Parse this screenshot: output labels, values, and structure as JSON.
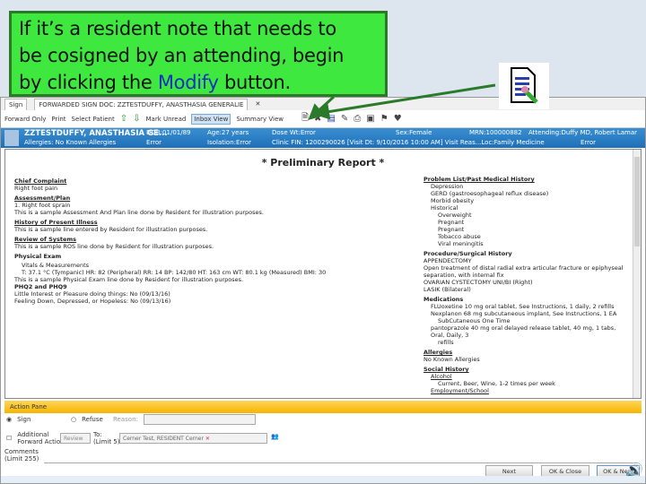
{
  "callout": {
    "line1": "If it’s a resident note that needs to",
    "line2": "be cosigned by an attending, begin",
    "line3_pre": "by clicking the ",
    "line3_hl": "Modify",
    "line3_post": " button."
  },
  "tabs": [
    {
      "label": "Sign"
    },
    {
      "label": "FORWARDED SIGN DOC: ZZTESTDUFFY, ANASTHASIA GENERALIE"
    }
  ],
  "toolbar": {
    "forward_only": "Forward Only",
    "print": "Print",
    "select_patient": "Select Patient",
    "mark_unread": "Mark Unread",
    "inbox_view": "Inbox View",
    "summary_view": "Summary View"
  },
  "banner": {
    "name": "ZZTESTDUFFY, ANASTHASIA GE...",
    "dob": "DOB:01/01/89",
    "age": "Age:27 years",
    "dose_wt": "Dose Wt:Error",
    "sex": "Sex:Female",
    "mrn": "MRN:100000882",
    "attending": "Attending:Duffy MD, Robert Lamar",
    "allergies": "Allergies: No Known Allergies",
    "err1": "Error",
    "isolation": "Isolation:Error",
    "clinic": "Clinic FIN: 1200290026 [Visit Dt: 9/10/2016 10:00 AM] Visit Reas...Loc:Family Medicine",
    "err2": "Error"
  },
  "report": {
    "title": "* Preliminary Report *",
    "left": [
      {
        "h": "Chief Complaint",
        "lines": [
          "Right foot pain"
        ]
      },
      {
        "h": "Assessment/Plan",
        "lines": [
          "1. Right foot sprain",
          "This is a sample Assessment And Plan line done by Resident for illustration purposes."
        ]
      },
      {
        "h": "History of Present Illness",
        "lines": [
          "This is a sample line entered by Resident for illustration purposes."
        ]
      },
      {
        "h": "Review of Systems",
        "lines": [
          "This is a sample ROS line done by Resident for illustration purposes."
        ]
      }
    ],
    "pe_h": "Physical Exam",
    "pe_vitals": "Vitals & Measurements",
    "pe_vals": "T: 37.1 °C (Tympanic)  HR: 82 (Peripheral)  RR: 14  BP: 142/80  HT: 163 cm  WT: 80.1 kg (Measured)  BMI: 30",
    "pe_line": "This is a sample Physical Exam line done by Resident for illustration purposes.",
    "phq_h": "PHQ2 and PHQ9",
    "phq1": "Little Interest or Pleasure doing things: No (09/13/16)",
    "phq2": "Feeling Down, Depressed, or Hopeless: No (09/13/16)",
    "problem_h": "Problem List/Past Medical History",
    "problems": [
      "Depression",
      "GERD (gastroesophageal reflux disease)",
      "Morbid obesity",
      "Historical"
    ],
    "historical": [
      "Overweight",
      "Pregnant",
      "Pregnant",
      "Tobacco abuse",
      "Viral meningitis"
    ],
    "proc_h": "Procedure/Surgical History",
    "procs": [
      "APPENDECTOMY",
      "Open treatment of distal radial extra articular fracture or epiphyseal",
      "separation, with internal fix",
      "OVARIAN CYSTECTOMY UNI/BI (Right)",
      "LASIK (Bilateral)"
    ],
    "med_h": "Medications",
    "meds": [
      "FLUoxetine 10 mg oral tablet, See Instructions, 1 daily, 2 refills",
      "Nexplanon 68 mg subcutaneous implant, See Instructions, 1 EA",
      "SubCutaneous One Time",
      "pantoprazole 40 mg oral delayed release tablet, 40 mg, 1 tabs, Oral, Daily, 3",
      "refills"
    ],
    "allergy_h": "Allergies",
    "allergy": "No Known Allergies",
    "social_h": "Social History",
    "alcohol_h": "Alcohol",
    "alcohol": "Current, Beer, Wine, 1-2 times per week",
    "employment_h": "Employment/School"
  },
  "action": {
    "title": "Action Pane",
    "sign": "Sign",
    "refuse": "Refuse",
    "reason": "Reason:",
    "additional": "Additional",
    "forward_action": "Forward Action:",
    "review": "Review",
    "to": "To:",
    "limit5": "(Limit 5)",
    "recipient": "Cerner Test, RESIDENT Cerner",
    "comments": "Comments",
    "limit255": "(Limit 255)",
    "next": "Next",
    "ok_close": "OK & Close",
    "ok_next": "OK & Next"
  }
}
